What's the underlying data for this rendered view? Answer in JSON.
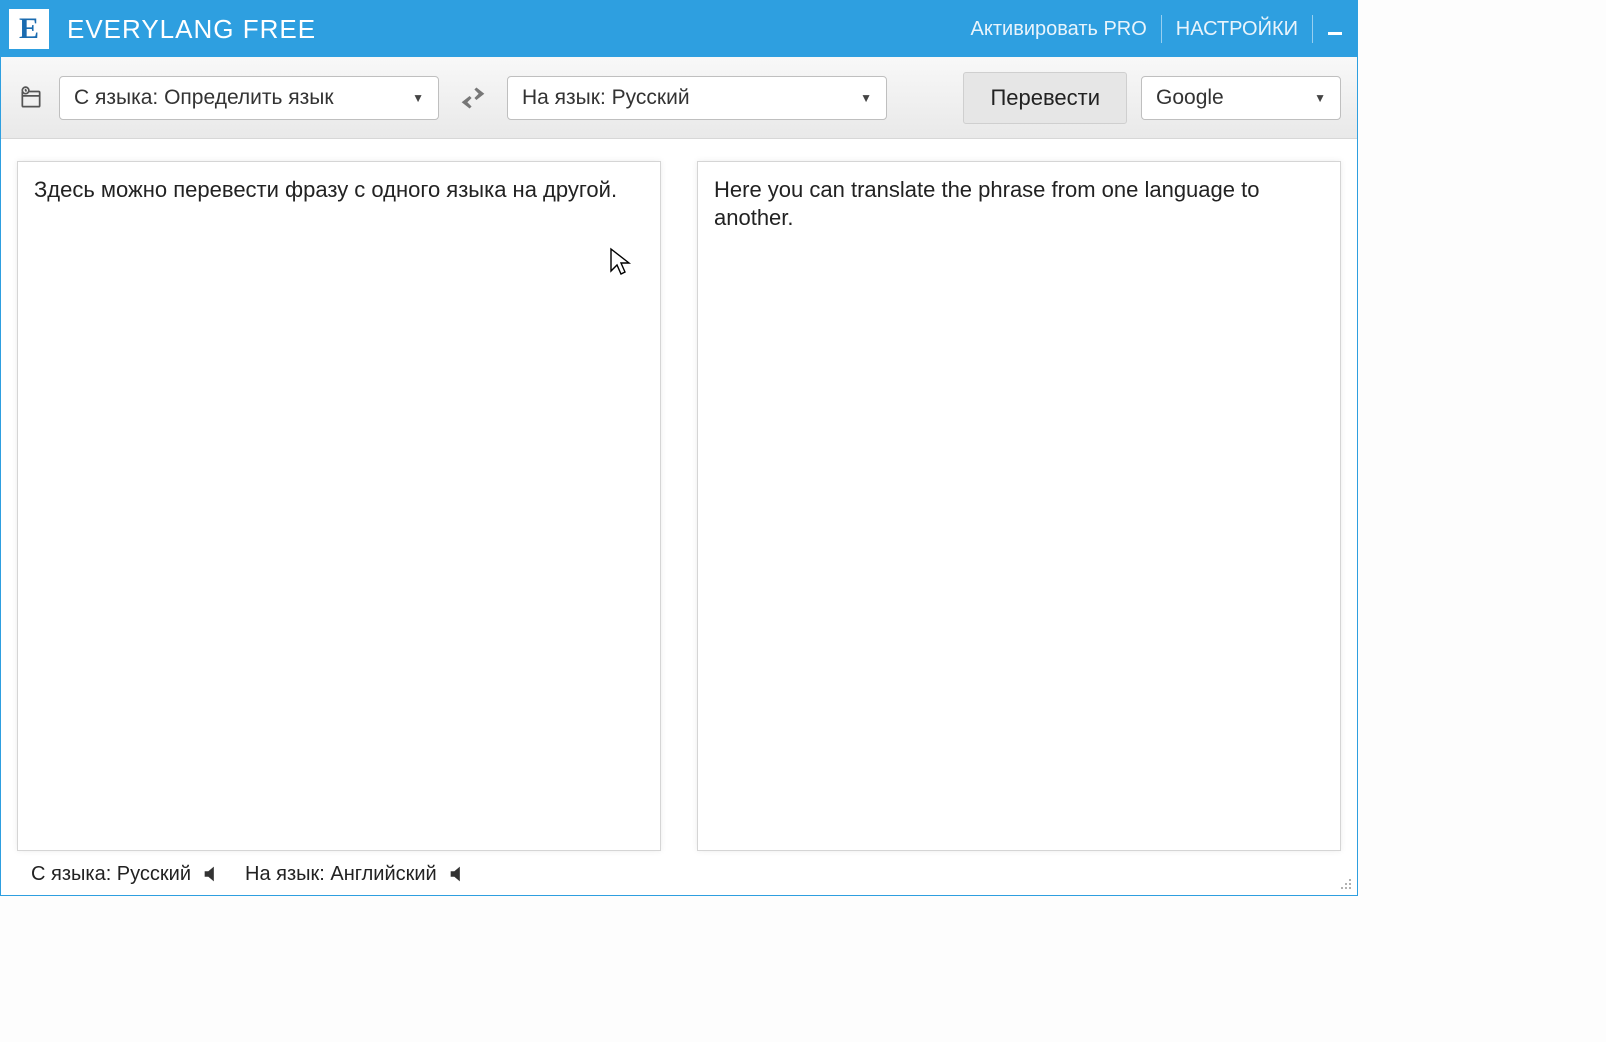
{
  "titlebar": {
    "app_title": "EVERYLANG FREE",
    "activate_pro": "Активировать PRO",
    "settings": "НАСТРОЙКИ"
  },
  "toolbar": {
    "source_lang_label": "С языка: Определить язык",
    "target_lang_label": "На язык: Русский",
    "translate_label": "Перевести",
    "engine_label": "Google"
  },
  "panes": {
    "source_text": "Здесь можно перевести фразу с одного языка на другой.",
    "target_text": "Here you can translate the phrase from one language to another."
  },
  "statusbar": {
    "source": "С языка: Русский",
    "target": "На язык: Английский"
  },
  "icons": {
    "app_logo_letter": "E"
  }
}
